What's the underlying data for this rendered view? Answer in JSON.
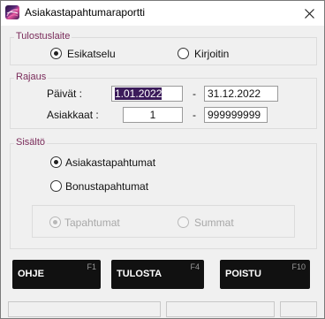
{
  "window": {
    "title": "Asiakastapahtumaraportti"
  },
  "tulostuslaite": {
    "label": "Tulostuslaite",
    "options": [
      {
        "label": "Esikatselu",
        "checked": true
      },
      {
        "label": "Kirjoitin",
        "checked": false
      }
    ]
  },
  "rajaus": {
    "label": "Rajaus",
    "dates_label": "Päivät :",
    "date_from": "1.01.2022",
    "date_to": "31.12.2022",
    "customers_label": "Asiakkaat :",
    "customer_from": "1",
    "customer_to": "999999999",
    "separator": "-"
  },
  "sisalto": {
    "label": "Sisältö",
    "options": [
      {
        "label": "Asiakastapahtumat",
        "checked": true
      },
      {
        "label": "Bonustapahtumat",
        "checked": false
      }
    ],
    "sub_options": [
      {
        "label": "Tapahtumat",
        "checked": true,
        "disabled": true
      },
      {
        "label": "Summat",
        "checked": false,
        "disabled": true
      }
    ]
  },
  "buttons": [
    {
      "label": "OHJE",
      "key": "F1"
    },
    {
      "label": "TULOSTA",
      "key": "F4"
    },
    {
      "label": "POISTU",
      "key": "F10"
    }
  ]
}
